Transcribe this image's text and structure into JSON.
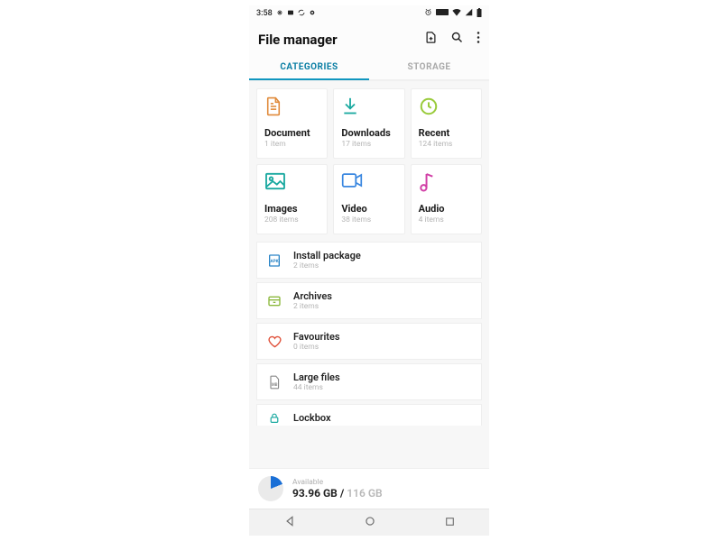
{
  "status": {
    "time": "3:58"
  },
  "header": {
    "title": "File manager"
  },
  "tabs": {
    "categories": "CATEGORIES",
    "storage": "STORAGE"
  },
  "cards": [
    {
      "name": "document",
      "label": "Document",
      "sub": "1 item",
      "icon": "doc",
      "color": "#e08a3a"
    },
    {
      "name": "downloads",
      "label": "Downloads",
      "sub": "17 items",
      "icon": "download",
      "color": "#1aa9a0"
    },
    {
      "name": "recent",
      "label": "Recent",
      "sub": "124 items",
      "icon": "clock",
      "color": "#9acb3c"
    },
    {
      "name": "images",
      "label": "Images",
      "sub": "208 items",
      "icon": "image",
      "color": "#1aa9a0"
    },
    {
      "name": "video",
      "label": "Video",
      "sub": "38 items",
      "icon": "video",
      "color": "#3a87e0"
    },
    {
      "name": "audio",
      "label": "Audio",
      "sub": "4 items",
      "icon": "audio",
      "color": "#d13fa6"
    }
  ],
  "lists": [
    {
      "name": "install-package",
      "label": "Install package",
      "sub": "2 items",
      "icon": "apk",
      "color": "#2a85c7"
    },
    {
      "name": "archives",
      "label": "Archives",
      "sub": "2 items",
      "icon": "archive",
      "color": "#8bb83c"
    },
    {
      "name": "favourites",
      "label": "Favourites",
      "sub": "0 items",
      "icon": "heart",
      "color": "#e0513a"
    },
    {
      "name": "large-files",
      "label": "Large files",
      "sub": "44 items",
      "icon": "large",
      "color": "#888888"
    },
    {
      "name": "lockbox",
      "label": "Lockbox",
      "sub": "",
      "icon": "lock",
      "color": "#1aa9a0"
    }
  ],
  "storage": {
    "label": "Available",
    "avail": "93.96 GB",
    "sep": " / ",
    "total": "116 GB"
  }
}
